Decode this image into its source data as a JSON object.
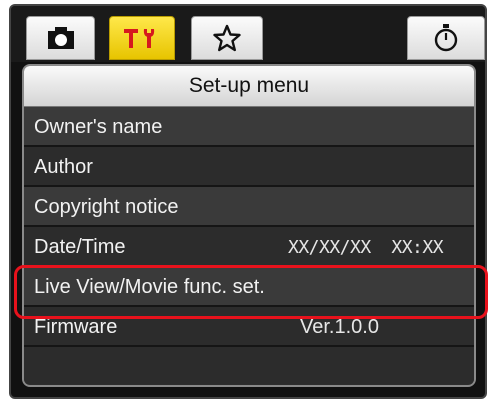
{
  "tabs": [
    {
      "id": "shooting",
      "icon": "camera-icon",
      "active": false
    },
    {
      "id": "setup",
      "icon": "wrench-icon",
      "active": true
    },
    {
      "id": "mymenu",
      "icon": "star-icon",
      "active": false
    },
    {
      "id": "timer",
      "icon": "stopwatch-icon",
      "active": false
    }
  ],
  "menu": {
    "title": "Set-up menu",
    "items": [
      {
        "label": "Owner's name",
        "value": ""
      },
      {
        "label": "Author",
        "value": ""
      },
      {
        "label": "Copyright notice",
        "value": ""
      },
      {
        "label": "Date/Time",
        "value": "XX/XX/XX  XX:XX"
      },
      {
        "label": "Live View/Movie func. set.",
        "value": ""
      },
      {
        "label": "Firmware",
        "value": "Ver.1.0.0"
      }
    ]
  },
  "colors": {
    "active_tab": "#f2d51a",
    "highlight": "#e8121c",
    "panel_bg": "#2e2e2e"
  }
}
